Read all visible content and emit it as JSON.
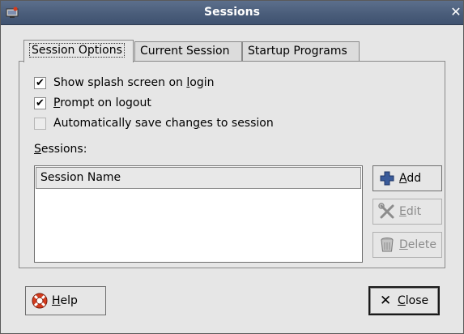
{
  "window": {
    "title": "Sessions"
  },
  "tabs": [
    {
      "label": "Session Options",
      "active": true
    },
    {
      "label": "Current Session",
      "active": false
    },
    {
      "label": "Startup Programs",
      "active": false
    }
  ],
  "options": [
    {
      "pre": "Show splash screen on ",
      "mnemonic": "l",
      "post": "ogin",
      "checked": true
    },
    {
      "pre": "",
      "mnemonic": "P",
      "post": "rompt on logout",
      "checked": true
    },
    {
      "pre": "Automatically save chan",
      "mnemonic": "g",
      "post": "es to session",
      "checked": false
    }
  ],
  "sessions_label": {
    "mnemonic": "S",
    "post": "essions:"
  },
  "sessions_list": {
    "column_header": "Session Name",
    "rows": []
  },
  "side_buttons": [
    {
      "mnemonic": "A",
      "post": "dd",
      "enabled": true,
      "icon": "plus-icon"
    },
    {
      "mnemonic": "E",
      "post": "dit",
      "enabled": false,
      "icon": "tools-icon"
    },
    {
      "mnemonic": "D",
      "post": "elete",
      "enabled": false,
      "icon": "trash-icon"
    }
  ],
  "help_button": {
    "mnemonic": "H",
    "post": "elp",
    "icon": "lifebuoy-icon"
  },
  "close_button": {
    "mnemonic": "C",
    "post": "lose",
    "icon": "close-x-icon"
  },
  "colors": {
    "titlebar": "#4a5d7a",
    "title_text": "#ffffff",
    "plus_accent": "#3a5b9a",
    "lifebuoy": "#d43c1e"
  }
}
